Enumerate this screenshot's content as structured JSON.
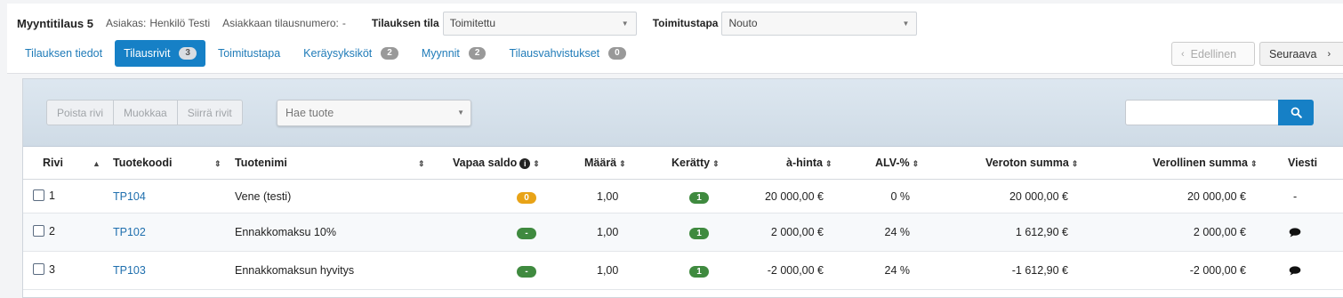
{
  "header": {
    "order_title": "Myyntitilaus 5",
    "customer_label": "Asiakas:",
    "customer_value": "Henkilö Testi",
    "customer_order_label": "Asiakkaan tilausnumero:",
    "customer_order_value": "-",
    "status_label": "Tilauksen tila",
    "status_value": "Toimitettu",
    "delivery_label": "Toimitustapa",
    "delivery_value": "Nouto"
  },
  "tabs": [
    {
      "label": "Tilauksen tiedot",
      "badge": ""
    },
    {
      "label": "Tilausrivit",
      "badge": "3"
    },
    {
      "label": "Toimitustapa",
      "badge": ""
    },
    {
      "label": "Keräysyksiköt",
      "badge": "2"
    },
    {
      "label": "Myynnit",
      "badge": "2"
    },
    {
      "label": "Tilausvahvistukset",
      "badge": "0"
    }
  ],
  "nav": {
    "prev_label": "Edellinen",
    "next_label": "Seuraava"
  },
  "toolbar": {
    "delete_label": "Poista rivi",
    "edit_label": "Muokkaa",
    "move_label": "Siirrä rivit",
    "product_search_placeholder": "Hae tuote",
    "search_value": ""
  },
  "table": {
    "columns": {
      "row": "Rivi",
      "code": "Tuotekoodi",
      "name": "Tuotenimi",
      "stock": "Vapaa saldo",
      "qty": "Määrä",
      "picked": "Kerätty",
      "unit_price": "à-hinta",
      "vat": "ALV-%",
      "net": "Veroton summa",
      "gross": "Verollinen summa",
      "message": "Viesti"
    },
    "rows": [
      {
        "row": "1",
        "code": "TP104",
        "name": "Vene (testi)",
        "stock": "0",
        "qty": "1,00",
        "picked": "1",
        "unit_price": "20 000,00 €",
        "vat": "0 %",
        "net": "20 000,00 €",
        "gross": "20 000,00 €",
        "message": "-"
      },
      {
        "row": "2",
        "code": "TP102",
        "name": "Ennakkomaksu 10%",
        "stock": "-",
        "qty": "1,00",
        "picked": "1",
        "unit_price": "2 000,00 €",
        "vat": "24 %",
        "net": "1 612,90 €",
        "gross": "2 000,00 €",
        "message": ""
      },
      {
        "row": "3",
        "code": "TP103",
        "name": "Ennakkomaksun hyvitys",
        "stock": "-",
        "qty": "1,00",
        "picked": "1",
        "unit_price": "-2 000,00 €",
        "vat": "24 %",
        "net": "-1 612,90 €",
        "gross": "-2 000,00 €",
        "message": ""
      }
    ]
  },
  "colors": {
    "accent": "#1680c6",
    "link": "#1f6fae",
    "badge_green": "#3f8a3f",
    "badge_orange": "#e8a317"
  },
  "icons": {
    "search": "search-icon",
    "chat": "chat-bubble-icon",
    "info": "info-icon"
  }
}
